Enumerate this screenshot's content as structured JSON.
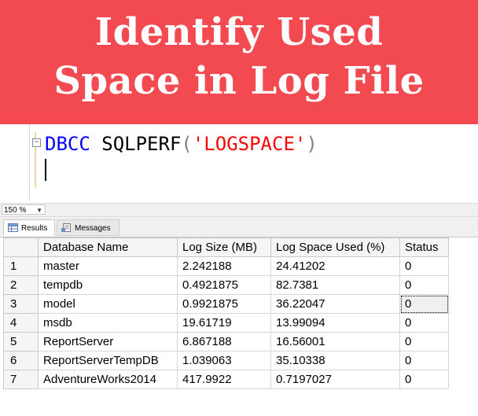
{
  "banner": {
    "line1": "Identify Used",
    "line2": "Space in Log File",
    "background": "#f24a50"
  },
  "editor": {
    "keyword": "DBCC",
    "command": "SQLPERF",
    "open_paren": "(",
    "argument": "'LOGSPACE'",
    "close_paren": ")",
    "collapse_glyph": "−"
  },
  "zoom": {
    "value": "150 %",
    "arrow": "▼"
  },
  "tabs": [
    {
      "label": "Results",
      "icon": "grid-icon"
    },
    {
      "label": "Messages",
      "icon": "messages-icon"
    }
  ],
  "results": {
    "columns": [
      "",
      "Database Name",
      "Log Size (MB)",
      "Log Space Used (%)",
      "Status"
    ],
    "rows": [
      [
        "1",
        "master",
        "2.242188",
        "24.41202",
        "0"
      ],
      [
        "2",
        "tempdb",
        "0.4921875",
        "82.7381",
        "0"
      ],
      [
        "3",
        "model",
        "0.9921875",
        "36.22047",
        "0"
      ],
      [
        "4",
        "msdb",
        "19.61719",
        "13.99094",
        "0"
      ],
      [
        "5",
        "ReportServer",
        "6.867188",
        "16.56001",
        "0"
      ],
      [
        "6",
        "ReportServerTempDB",
        "1.039063",
        "35.10338",
        "0"
      ],
      [
        "7",
        "AdventureWorks2014",
        "417.9922",
        "0.7197027",
        "0"
      ]
    ]
  }
}
